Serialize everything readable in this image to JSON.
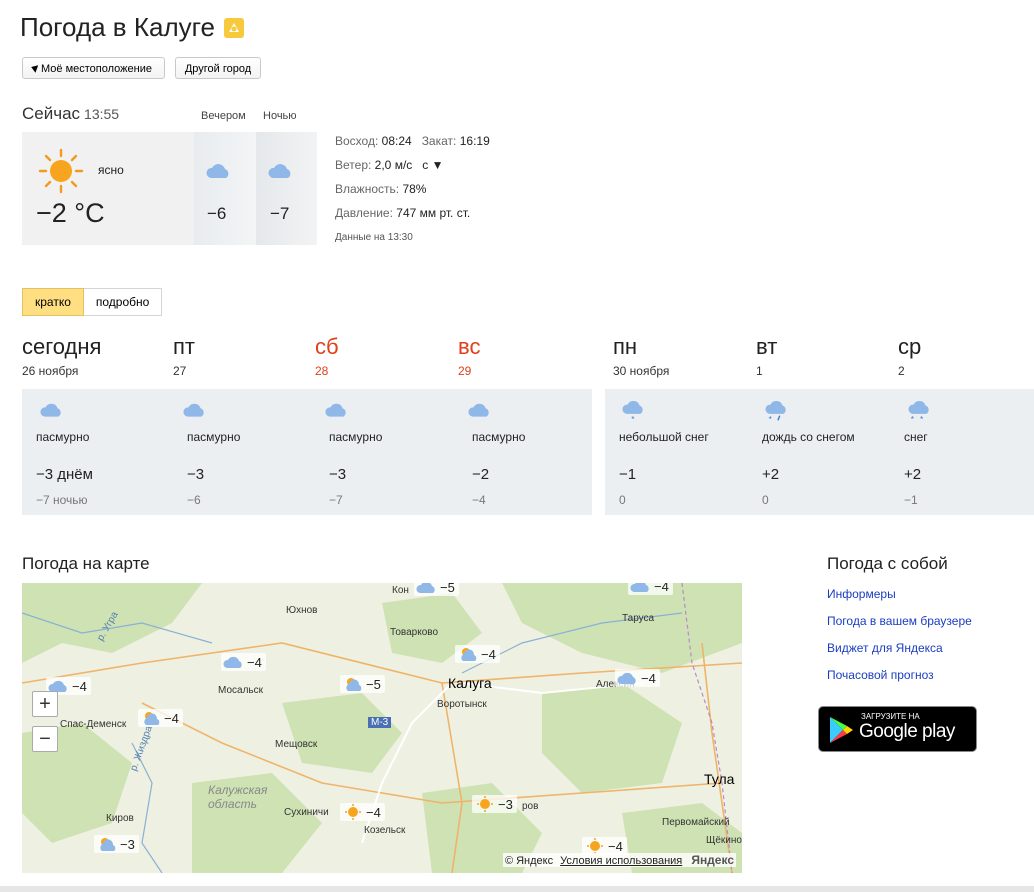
{
  "header": {
    "title": "Погода в Калуге",
    "location_button": "Моё местоположение",
    "city_button": "Другой город"
  },
  "now": {
    "label": "Сейчас",
    "time": "13:55",
    "evening_label": "Вечером",
    "night_label": "Ночью",
    "condition": "ясно",
    "temp": "−2 °C",
    "evening_temp": "−6",
    "night_temp": "−7",
    "sunrise_label": "Восход:",
    "sunrise": "08:24",
    "sunset_label": "Закат:",
    "sunset": "16:19",
    "wind_label": "Ветер:",
    "wind": "2,0 м/с",
    "wind_dir": "с ▼",
    "humidity_label": "Влажность:",
    "humidity": "78%",
    "pressure_label": "Давление:",
    "pressure": "747 мм рт. ст.",
    "data_at": "Данные на 13:30"
  },
  "tabs": [
    {
      "label": "кратко",
      "active": true
    },
    {
      "label": "подробно",
      "active": false
    }
  ],
  "forecast": [
    {
      "day": "сегодня",
      "date": "26 ноября",
      "icon": "cloud-icon",
      "cond": "пасмурно",
      "day_temp": "−3 днём",
      "night_temp": "−7 ночью",
      "weekend": false
    },
    {
      "day": "пт",
      "date": "27",
      "icon": "cloud-icon",
      "cond": "пасмурно",
      "day_temp": "−3",
      "night_temp": "−6",
      "weekend": false
    },
    {
      "day": "сб",
      "date": "28",
      "icon": "cloud-icon",
      "cond": "пасмурно",
      "day_temp": "−3",
      "night_temp": "−7",
      "weekend": true
    },
    {
      "day": "вс",
      "date": "29",
      "icon": "cloud-icon",
      "cond": "пасмурно",
      "day_temp": "−2",
      "night_temp": "−4",
      "weekend": true
    },
    {
      "day": "пн",
      "date": "30 ноября",
      "icon": "light-snow-icon",
      "cond": "небольшой снег",
      "day_temp": "−1",
      "night_temp": "0",
      "weekend": false
    },
    {
      "day": "вт",
      "date": "1",
      "icon": "rain-snow-icon",
      "cond": "дождь со снегом",
      "day_temp": "+2",
      "night_temp": "0",
      "weekend": false
    },
    {
      "day": "ср",
      "date": "2",
      "icon": "snow-icon",
      "cond": "снег",
      "day_temp": "+2",
      "night_temp": "−1",
      "weekend": false
    }
  ],
  "map": {
    "title": "Погода на карте",
    "city_labels": [
      "Калуга",
      "Тула"
    ],
    "place_labels": [
      "Кон",
      "Юхнов",
      "Товарково",
      "Таруса",
      "Мосальск",
      "Воротынск",
      "Алексин",
      "Спас-Деменск",
      "Мещовск",
      "Калужская область",
      "Сухиничи",
      "Козельск",
      "Киров",
      "Первомайский",
      "Щёкино",
      "р. Угра",
      "р. Жиздра",
      "М-3",
      "ров"
    ],
    "weather_marks": [
      "−5",
      "−4",
      "−4",
      "−4",
      "−4",
      "−4",
      "−5",
      "−4",
      "−4",
      "−3",
      "−3",
      "−4"
    ],
    "copyright": "© Яндекс",
    "terms": "Условия использования",
    "brand": "Яндекс",
    "zoom_in": "+",
    "zoom_out": "−"
  },
  "side": {
    "title": "Погода с собой",
    "links": [
      "Информеры",
      "Погода в вашем браузере",
      "Виджет для Яндекса",
      "Почасовой прогноз"
    ],
    "badge_small": "ЗАГРУЗИТЕ НА",
    "badge_big": "Google play"
  }
}
